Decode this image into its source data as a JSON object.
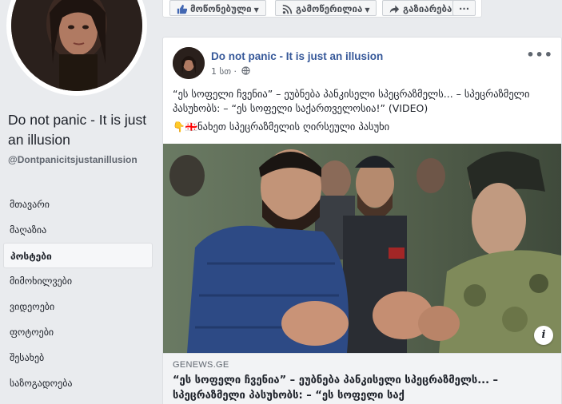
{
  "sidebar": {
    "page_name": "Do not panic - It is just an illusion",
    "handle": "@Dontpanicitsjustanillusion",
    "nav_items": [
      {
        "label": "მთავარი",
        "active": false
      },
      {
        "label": "მაღაზია",
        "active": false
      },
      {
        "label": "პოსტები",
        "active": true
      },
      {
        "label": "მიმოხილვები",
        "active": false
      },
      {
        "label": "ვიდეოები",
        "active": false
      },
      {
        "label": "ფოტოები",
        "active": false
      },
      {
        "label": "შესახებ",
        "active": false
      },
      {
        "label": "საზოგადოება",
        "active": false
      }
    ]
  },
  "actionbar": {
    "like_label": "მოწონებული",
    "follow_label": "გამოწერილია",
    "share_label": "გაზიარება",
    "more_label": "···"
  },
  "post": {
    "author": "Do not panic - It is just an illusion",
    "time": "1 სთ ·",
    "more": "•••",
    "text_line1": "“ეს სოფელი ჩვენია” – ეუბნება პანკისელი სპეცრაზმელს... – სპეცრაზმელი პასუხობს: – “ეს სოფელი საქართველოსია!” (VIDEO)",
    "text_line2": "👇🇬🇪ნახეთ სპეცრაზმელის ღირსეული პასუხი",
    "link": {
      "domain": "GENEWS.GE",
      "title": "“ეს სოფელი ჩვენია” – ეუბნება პანკისელი სპეცრაზმელს... – სპეცრაზმელი პასუხობს: – “ეს სოფელი საქ"
    },
    "info_icon": "i"
  },
  "colors": {
    "link_blue": "#365899",
    "background": "#e9ebee",
    "border": "#dddfe2"
  }
}
